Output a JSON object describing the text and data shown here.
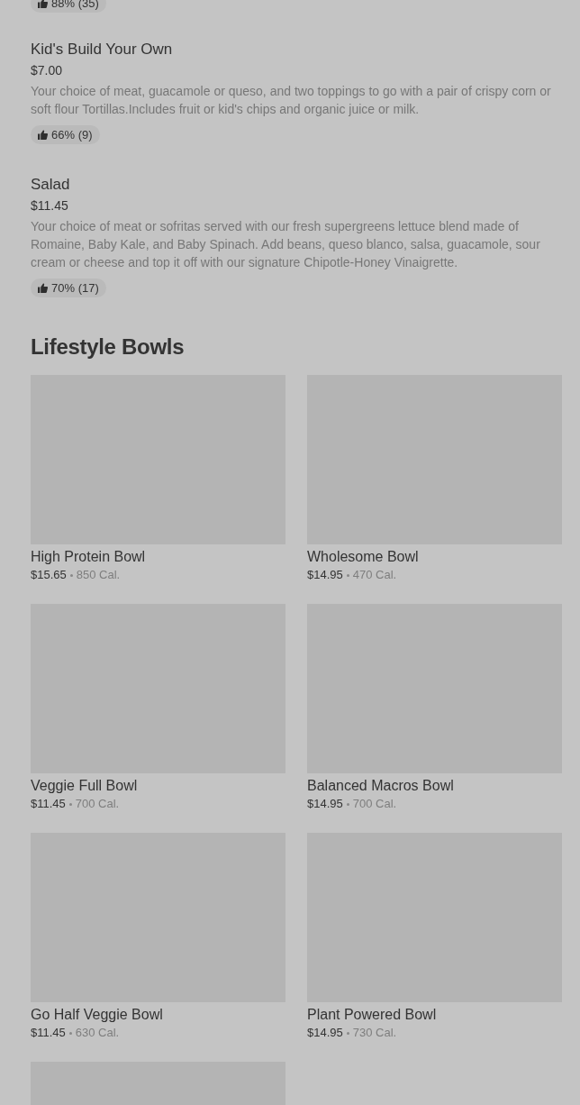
{
  "menu_items": [
    {
      "badge": "88% (35)",
      "partial": true
    },
    {
      "name": "Kid's Build Your Own",
      "price": "$7.00",
      "description": "Your choice of meat, guacamole or queso, and two toppings to go with a pair of crispy corn or soft flour Tortillas.Includes fruit or kid's chips and organic juice or milk.",
      "badge": "66% (9)"
    },
    {
      "name": "Salad",
      "price": "$11.45",
      "description": "Your choice of meat or sofritas served with our fresh supergreens lettuce blend made of Romaine, Baby Kale, and Baby Spinach. Add beans, queso blanco, salsa, guacamole, sour cream or cheese and top it off with our signature Chipotle-Honey Vinaigrette.",
      "badge": "70% (17)"
    }
  ],
  "section": {
    "title": "Lifestyle Bowls",
    "cards": [
      {
        "kind": "full",
        "name": "High Protein Bowl",
        "price": "$15.65",
        "calories": "850 Cal."
      },
      {
        "kind": "full",
        "name": "Wholesome Bowl",
        "price": "$14.95",
        "calories": "470 Cal."
      },
      {
        "kind": "full",
        "name": "Veggie Full Bowl",
        "price": "$11.45",
        "calories": "700 Cal."
      },
      {
        "kind": "full",
        "name": "Balanced Macros Bowl",
        "price": "$14.95",
        "calories": "700 Cal."
      },
      {
        "kind": "full",
        "name": "Go Half Veggie Bowl",
        "price": "$11.45",
        "calories": "630 Cal."
      },
      {
        "kind": "full",
        "name": "Plant Powered Bowl",
        "price": "$14.95",
        "calories": "730 Cal."
      },
      {
        "kind": "image-only"
      }
    ]
  }
}
